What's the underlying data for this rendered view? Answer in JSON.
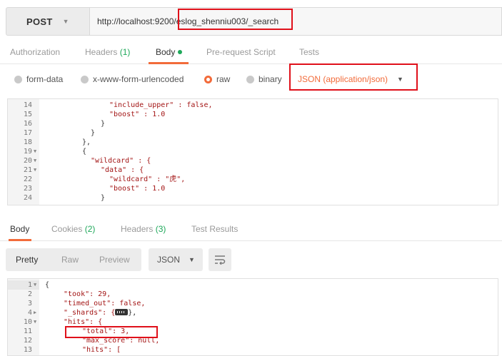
{
  "request": {
    "method": "POST",
    "url": "http://localhost:9200/eslog_shenniu003/_search"
  },
  "request_tabs": [
    {
      "label": "Authorization"
    },
    {
      "label": "Headers",
      "count": "(1)"
    },
    {
      "label": "Body"
    },
    {
      "label": "Pre-request Script"
    },
    {
      "label": "Tests"
    }
  ],
  "body_types": [
    "form-data",
    "x-www-form-urlencoded",
    "raw",
    "binary"
  ],
  "body_selected": "raw",
  "content_type": "JSON (application/json)",
  "request_code": {
    "lines": [
      "14",
      "15",
      "16",
      "17",
      "18",
      "19",
      "20",
      "21",
      "22",
      "23",
      "24"
    ],
    "text": [
      "\"include_upper\" : false,",
      "\"boost\" : 1.0",
      "}",
      "}",
      "},",
      "{",
      "\"wildcard\" : {",
      "\"data\" : {",
      "\"wildcard\" : \"虎\",",
      "\"boost\" : 1.0",
      "}"
    ]
  },
  "response_tabs": [
    {
      "label": "Body"
    },
    {
      "label": "Cookies",
      "count": "(2)"
    },
    {
      "label": "Headers",
      "count": "(3)"
    },
    {
      "label": "Test Results"
    }
  ],
  "view_modes": [
    "Pretty",
    "Raw",
    "Preview"
  ],
  "view_format": "JSON",
  "response_code": {
    "lines": [
      "1",
      "2",
      "3",
      "4",
      "10",
      "11",
      "12",
      "13"
    ],
    "text": [
      "{",
      "\"took\": 29,",
      "\"timed_out\": false,",
      "\"_shards\": {",
      "\"hits\": {",
      "\"total\": 3,",
      "\"max_score\": null,",
      "\"hits\": ["
    ],
    "shards_suffix": "},"
  },
  "colors": {
    "accent": "#f26b3a",
    "green": "#1ea85a",
    "annotation": "#e0101a"
  }
}
